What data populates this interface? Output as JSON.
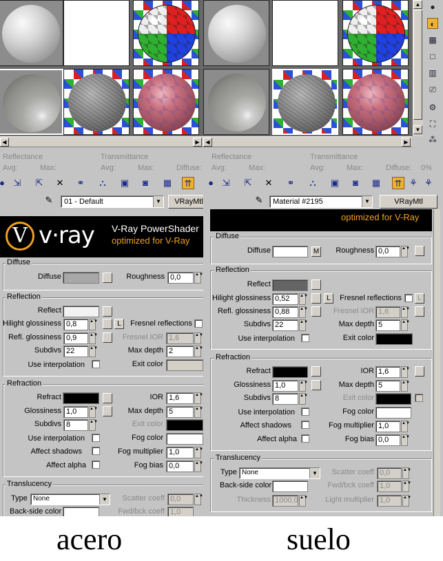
{
  "left": {
    "stats": {
      "reflectance": "Reflectance",
      "avg": "Avg:",
      "max": "Max:",
      "transmittance": "Transmittance",
      "avg2": "Avg:",
      "max2": "Max:",
      "diffuse": "Diffuse:"
    },
    "material_name": "01 - Default",
    "material_type": "VRayMtl",
    "banner": {
      "line1": "V-Ray PowerShader",
      "line2": "optimized for V-Ray"
    },
    "logo_text": "v·ray",
    "logo_v": "V",
    "diffuse": {
      "title": "Diffuse",
      "diffuse_label": "Diffuse",
      "roughness_label": "Roughness",
      "roughness": "0,0"
    },
    "reflection": {
      "title": "Reflection",
      "reflect_label": "Reflect",
      "hilight_label": "Hilight glossiness",
      "hilight": "0,8",
      "l_button": "L",
      "fresnel_label": "Fresnel reflections",
      "refl_gloss_label": "Refl. glossiness",
      "refl_gloss": "0,9",
      "fresnel_ior_label": "Fresnel IOR",
      "fresnel_ior": "1,6",
      "subdivs_label": "Subdivs",
      "subdivs": "22",
      "max_depth_label": "Max depth",
      "max_depth": "2",
      "interp_label": "Use interpolation",
      "exit_label": "Exit color"
    },
    "refraction": {
      "title": "Refraction",
      "refract_label": "Refract",
      "ior_label": "IOR",
      "ior": "1,6",
      "gloss_label": "Glossiness",
      "gloss": "1,0",
      "max_depth_label": "Max depth",
      "max_depth": "5",
      "subdivs_label": "Subdivs",
      "subdivs": "8",
      "exit_label": "Exit color",
      "interp_label": "Use interpolation",
      "fog_label": "Fog color",
      "shadows_label": "Affect shadows",
      "fog_mult_label": "Fog multiplier",
      "fog_mult": "1,0",
      "alpha_label": "Affect alpha",
      "fog_bias_label": "Fog bias",
      "fog_bias": "0,0"
    },
    "translucency": {
      "title": "Translucency",
      "type_label": "Type",
      "type": "None",
      "scatter_label": "Scatter coeff",
      "scatter": "0,0",
      "backside_label": "Back-side color",
      "fwd_label": "Fwd/bck coeff",
      "fwd": "1,0"
    }
  },
  "right": {
    "stats": {
      "reflectance": "Reflectance",
      "avg": "Avg:",
      "max": "Max:",
      "transmittance": "Transmittance",
      "avg2": "Avg:",
      "max2": "Max:",
      "diffuse": "Diffuse:",
      "pct": "0%"
    },
    "material_name": "Material #2195",
    "material_type": "VRayMtl",
    "banner": {
      "line1": "optimized for V-Ray"
    },
    "diffuse": {
      "title": "Diffuse",
      "diffuse_label": "Diffuse",
      "m_button": "M",
      "roughness_label": "Roughness",
      "roughness": "0,0"
    },
    "reflection": {
      "title": "Reflection",
      "reflect_label": "Reflect",
      "hilight_label": "Hilight glossiness",
      "hilight": "0,52",
      "l_button": "L",
      "fresnel_label": "Fresnel reflections",
      "refl_gloss_label": "Refl. glossiness",
      "refl_gloss": "0,88",
      "fresnel_ior_label": "Fresnel IOR",
      "fresnel_ior": "1,6",
      "subdivs_label": "Subdivs",
      "subdivs": "22",
      "max_depth_label": "Max depth",
      "max_depth": "5",
      "interp_label": "Use interpolation",
      "exit_label": "Exit color"
    },
    "refraction": {
      "title": "Refraction",
      "refract_label": "Refract",
      "ior_label": "IOR",
      "ior": "1,6",
      "gloss_label": "Glossiness",
      "gloss": "1,0",
      "max_depth_label": "Max depth",
      "max_depth": "5",
      "subdivs_label": "Subdivs",
      "subdivs": "8",
      "exit_label": "Exit color",
      "interp_label": "Use interpolation",
      "fog_label": "Fog color",
      "shadows_label": "Affect shadows",
      "fog_mult_label": "Fog multiplier",
      "fog_mult": "1,0",
      "alpha_label": "Affect alpha",
      "fog_bias_label": "Fog bias",
      "fog_bias": "0,0"
    },
    "translucency": {
      "title": "Translucency",
      "type_label": "Type",
      "type": "None",
      "scatter_label": "Scatter coeff",
      "scatter": "0,0",
      "backside_label": "Back-side color",
      "fwd_label": "Fwd/bck coeff",
      "fwd": "1,0",
      "thickness_label": "Thickness",
      "thickness": "1000,0",
      "light_mult_label": "Light multiplier",
      "light_mult": "1,0"
    }
  },
  "captions": {
    "left": "acero",
    "right": "suelo"
  },
  "colors": {
    "reflect_left": "#f2f2f2",
    "diffuse_left": "#a8a8a8",
    "reflect_right": "#646464",
    "diffuse_right": "#ffffff",
    "refract": "#000000",
    "fog": "#ffffff",
    "exit_left": "#000000",
    "exit_right": "#000000",
    "vray_orange": "#f0a020"
  },
  "toolbar_icons": [
    "sphere-icon",
    "get-material-icon",
    "put-material-icon",
    "reset-icon",
    "make-unique-icon",
    "put-library-icon",
    "material-id-icon",
    "show-in-viewport-icon",
    "show-end-result-icon",
    "go-parent-icon",
    "go-sibling-icon"
  ],
  "side_icons": [
    "sample-type-icon",
    "backlight-icon",
    "background-icon",
    "uv-tiling-icon",
    "video-check-icon",
    "make-preview-icon",
    "options-icon",
    "select-by-material-icon",
    "material-navigator-icon"
  ]
}
